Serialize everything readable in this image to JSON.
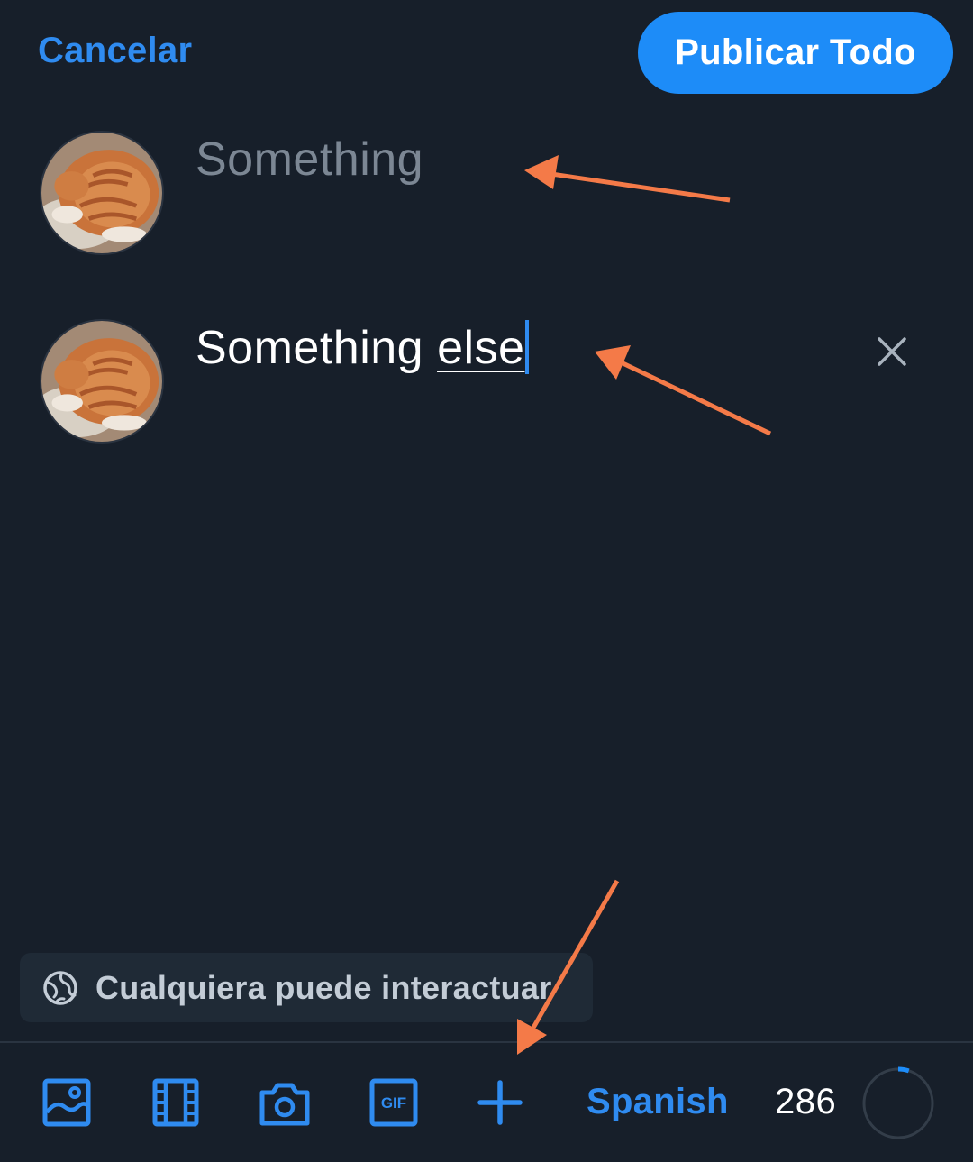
{
  "header": {
    "cancel_label": "Cancelar",
    "publish_label": "Publicar Todo"
  },
  "thread": [
    {
      "text": "Something",
      "state": "inactive"
    },
    {
      "text_prefix": "Something",
      "text_underlined": "else",
      "state": "active"
    }
  ],
  "interaction_setting": {
    "label": "Cualquiera puede interactuar",
    "icon": "globe-icon"
  },
  "toolbar": {
    "icons": [
      "image-icon",
      "video-icon",
      "camera-icon",
      "gif-icon",
      "add-post-icon"
    ],
    "gif_label": "GIF",
    "language": "Spanish",
    "char_count": "286",
    "char_progress_fraction": 0.05
  },
  "colors": {
    "background": "#171f2a",
    "accent": "#1d8cf8",
    "link": "#2f8bf0",
    "annotation_arrow": "#f47a48"
  }
}
